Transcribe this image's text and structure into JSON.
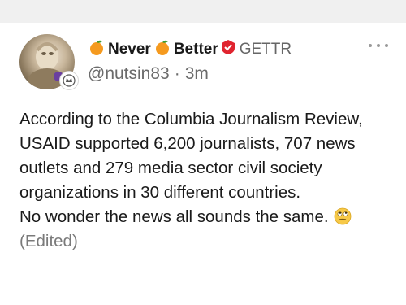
{
  "post": {
    "author": {
      "name_part1": "Never",
      "name_part2": "Better",
      "brand": "GETTR",
      "handle": "@nutsin83",
      "separator": "·",
      "time": "3m"
    },
    "body_lines": [
      "According to the Columbia Journalism Review, USAID supported 6,200 journalists, 707 news outlets and 279 media sector civil society organizations in 30 different countries."
    ],
    "second_line": "No wonder the news all sounds the same.",
    "edited_label": "(Edited)",
    "icons": {
      "name_icon_1": "orange-fruit-icon",
      "name_icon_2": "orange-fruit-icon",
      "verified": "gettr-verified-badge-icon",
      "menu": "more-options-icon",
      "avatar_badge": "tier-badge-icon",
      "emoji": "eye-roll-face-icon"
    },
    "colors": {
      "brand_red": "#e0242f",
      "orange": "#f59a1f",
      "leaf": "#3f9c35",
      "muted": "#6b6b6b"
    }
  }
}
